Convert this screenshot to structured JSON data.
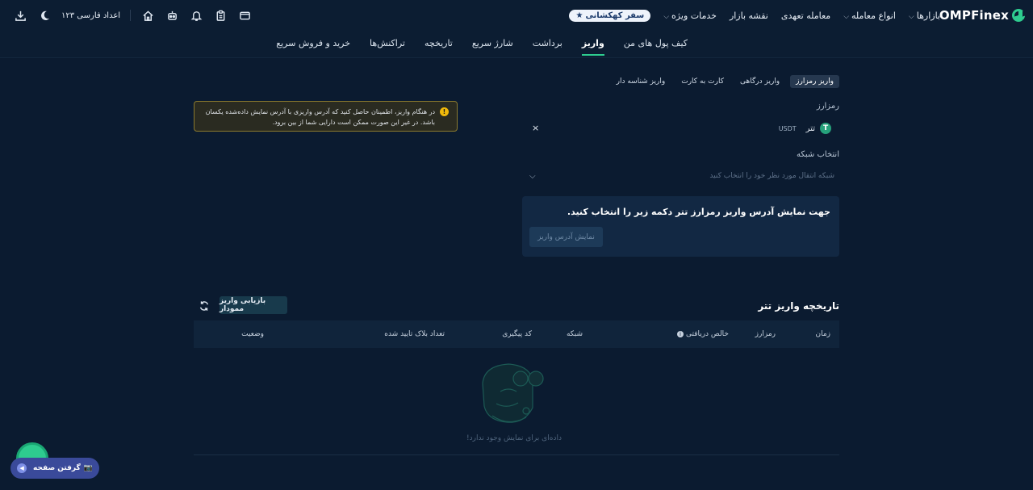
{
  "header": {
    "logo_text": "OMPFinex",
    "menu": [
      {
        "label": "بازارها",
        "has_chevron": true
      },
      {
        "label": "انواع معامله",
        "has_chevron": true
      },
      {
        "label": "معامله تعهدی",
        "has_chevron": false
      },
      {
        "label": "نقشه بازار",
        "has_chevron": false
      },
      {
        "label": "خدمات ویژه",
        "has_chevron": true
      }
    ],
    "promo_label": "سفر کهکشانی",
    "numerals_label": "اعداد فارسی ۱۲۳",
    "icons": [
      "wallet-icon",
      "clipboard-icon",
      "bell-icon",
      "robot-icon",
      "home-icon",
      "moon-icon",
      "download-icon"
    ]
  },
  "subnav": {
    "items": [
      "کیف پول های من",
      "واریز",
      "برداشت",
      "شارژ سریع",
      "تاریخچه",
      "تراکنش‌ها",
      "خرید و فروش سریع"
    ],
    "active_index": 1
  },
  "deposit": {
    "tabs": [
      "واریز رمزارز",
      "واریز درگاهی",
      "کارت به کارت",
      "واریز شناسه دار"
    ],
    "active_tab": 0,
    "crypto_label": "رمزارز",
    "coin_name": "تتر",
    "coin_symbol": "USDT",
    "network_label": "انتخاب شبکه",
    "network_placeholder": "شبکه انتقال مورد نظر خود را انتخاب کنید",
    "panel_title": "جهت نمایش آدرس واریز رمزارز تتر دکمه زیر را انتخاب کنید.",
    "show_address_button": "نمایش آدرس واریز",
    "warning_text": "در هنگام واریز، اطمینان حاصل کنید که آدرس واریزی با آدرس نمایش داده‌شده یکسان باشد. در غیر این صورت ممکن است دارایی شما از بین برود."
  },
  "history": {
    "title": "تاریخچه واریز تتر",
    "recover_button": "بازیابی واریز ممودار",
    "columns": [
      "زمان",
      "رمزارز",
      "خالص دریافتی",
      "شبکه",
      "کد پیگیری",
      "تعداد بلاک تایید شده",
      "وضعیت"
    ],
    "empty_text": "داده‌ای برای نمایش وجود ندارد!"
  },
  "float_button": {
    "label": "گرفتن صفحه"
  },
  "colors": {
    "accent": "#2ecc8f",
    "background": "#0b1b30",
    "warning_border": "#8b7a2e"
  }
}
